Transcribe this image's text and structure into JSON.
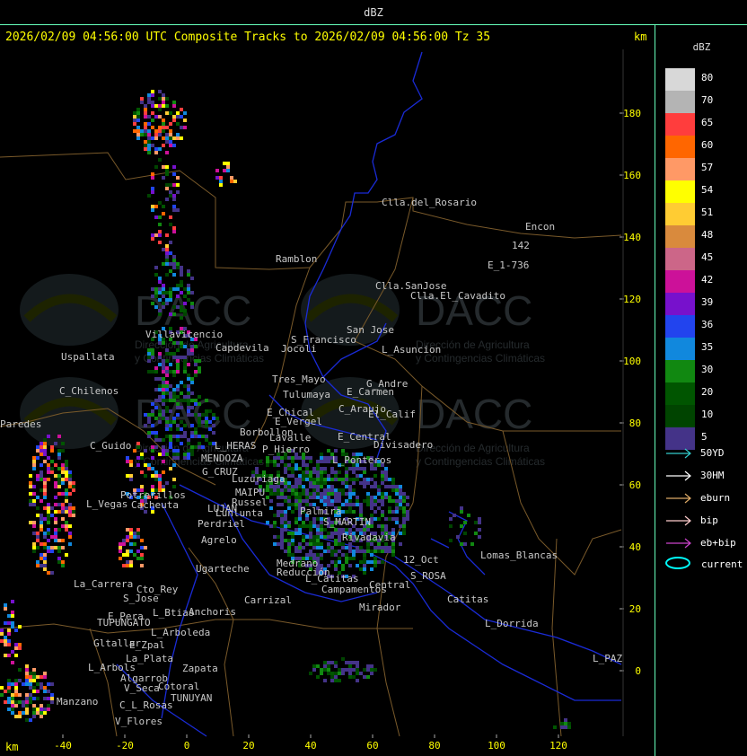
{
  "header": {
    "unit_title": "dBZ"
  },
  "title": "2026/02/09 04:56:00 UTC Composite Tracks to 2026/02/09 04:56:00 Tz 35",
  "km_label_top": "km",
  "km_label_bottom": "km",
  "watermark": {
    "brand": "DACC",
    "line1": "Dirección de Agricultura",
    "line2": "y Contingencias Climáticas"
  },
  "axes": {
    "x_ticks": [
      "-40",
      "-20",
      "0",
      "20",
      "40",
      "60",
      "80",
      "100",
      "120"
    ],
    "y_ticks": [
      "180",
      "160",
      "140",
      "120",
      "100",
      "80",
      "60",
      "40",
      "20",
      "0"
    ]
  },
  "legend": {
    "title": "dBZ",
    "scale": [
      {
        "label": "80",
        "color": "#d8d8d8"
      },
      {
        "label": "70",
        "color": "#b4b4b4"
      },
      {
        "label": "65",
        "color": "#ff3d3d"
      },
      {
        "label": "60",
        "color": "#ff6600"
      },
      {
        "label": "57",
        "color": "#ff9966"
      },
      {
        "label": "54",
        "color": "#ffff00"
      },
      {
        "label": "51",
        "color": "#ffcc33"
      },
      {
        "label": "48",
        "color": "#d98a3d"
      },
      {
        "label": "45",
        "color": "#cc6688"
      },
      {
        "label": "42",
        "color": "#cc1199"
      },
      {
        "label": "39",
        "color": "#7711cc"
      },
      {
        "label": "36",
        "color": "#2244ee"
      },
      {
        "label": "35",
        "color": "#1188dd"
      },
      {
        "label": "30",
        "color": "#118811"
      },
      {
        "label": "20",
        "color": "#005500"
      },
      {
        "label": "10",
        "color": "#004400"
      },
      {
        "label": "5",
        "color": "#443388"
      }
    ],
    "tracks": [
      {
        "label": "50YD",
        "color": "#33cccc"
      },
      {
        "label": "30HM",
        "color": "#ffffff"
      },
      {
        "label": "eburn",
        "color": "#ddaa66"
      },
      {
        "label": "bip",
        "color": "#ffcccc"
      },
      {
        "label": "eb+bip",
        "color": "#cc44cc"
      }
    ],
    "current_label": "current"
  },
  "places": [
    "Clla.del_Rosario",
    "Ramblon",
    "Encon",
    "E_1-736",
    "142",
    "Clla.SanJose",
    "Clla.El_Cavadito",
    "Uspallata",
    "Villavicencio",
    "Capdevila",
    "S_Francisco",
    "Jocoli",
    "San Jose",
    "L_Asuncion",
    "C_Chilenos",
    "Tres_Mayo",
    "Tulumaya",
    "G_Andre",
    "E_Carmen",
    "E_Chical",
    "C_Araujo",
    "El_Calif",
    "Paredes",
    "E_Vergel",
    "Borbollon",
    "Lavalle",
    "E_Central",
    "Divisadero",
    "C_Guido",
    "L_HERAS",
    "P_Hierro",
    "MENDOZA",
    "Potrerillos",
    "G_CRUZ",
    "L_Ponteros",
    "Luzuriaga",
    "L_Vegas",
    "Cacheuta",
    "MAIPU",
    "Russel",
    "LUJAN",
    "Lunlunta",
    "Perdriel",
    "Agrelo",
    "S_MARTIN",
    "Ugarteche",
    "La_Carrera",
    "Cto_Rey",
    "S_Jose",
    "E_Pera",
    "TUPUNGATO",
    "Carrizal",
    "Anchoris",
    "L_Btias",
    "12_Oct",
    "Lomas_Blancas",
    "S_ROSA",
    "Catitas",
    "Central",
    "Campamentos",
    "Mirador",
    "L_Arboleda",
    "E_Zpal",
    "Gltallar",
    "L_Dorrida",
    "L_PAZ",
    "La_Plata",
    "Zapata",
    "L_Arbols",
    "Algarrob",
    "V_Seca",
    "Cotoral",
    "TUNUYAN",
    "Manzano",
    "C_L_Rosas",
    "V_Flores",
    "Palmira",
    "Rivadavia",
    "Medrano",
    "Reducción",
    "L_Catitas"
  ]
}
